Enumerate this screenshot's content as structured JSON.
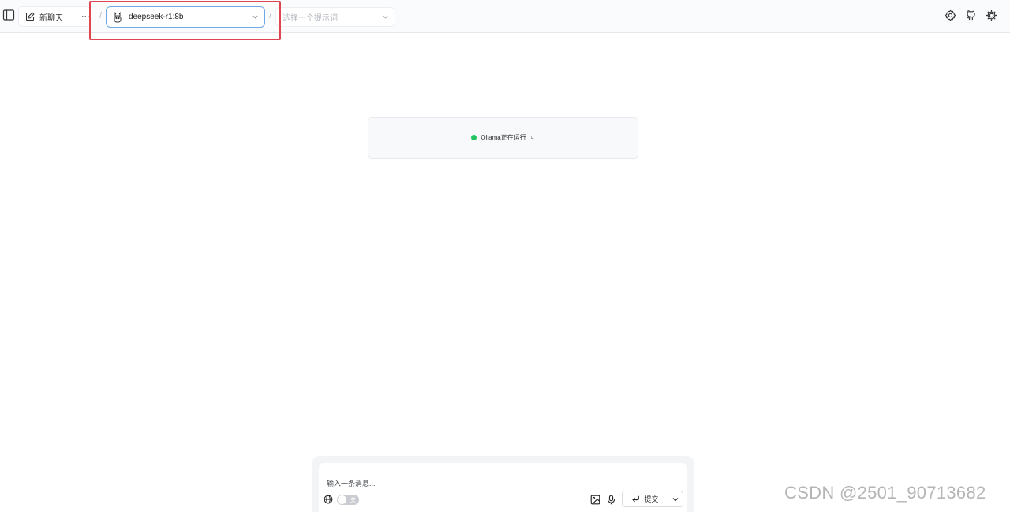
{
  "header": {
    "new_chat_label": "新聊天",
    "more_label": "···",
    "separator": "/",
    "model_select_value": "deepseek-r1:8b",
    "prompt_select_placeholder": "选择一个提示词"
  },
  "status": {
    "text": "Ollama正在运行",
    "link_icon": "↳",
    "dot_color": "#22c55e"
  },
  "composer": {
    "placeholder": "输入一条消息...",
    "web_toggle_label": "关",
    "submit_label": "提交"
  },
  "watermark": "CSDN @2501_90713682",
  "colors": {
    "highlight": "#e0454f",
    "select_border": "#6fa8e6"
  }
}
